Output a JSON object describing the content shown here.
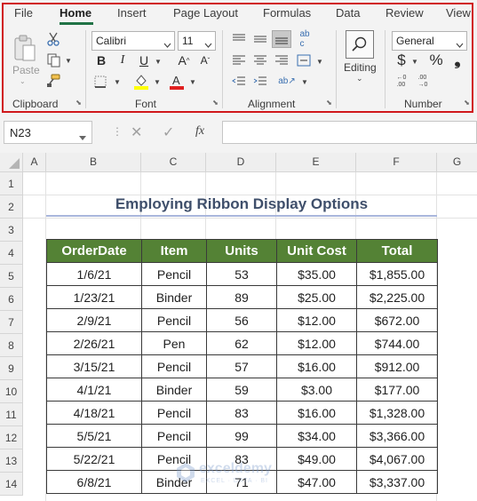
{
  "menu": {
    "tabs": [
      "File",
      "Home",
      "Insert",
      "Page Layout",
      "Formulas",
      "Data",
      "Review",
      "View"
    ],
    "active": "Home"
  },
  "ribbon": {
    "clipboard": {
      "label": "Clipboard",
      "paste_label": "Paste"
    },
    "font": {
      "label": "Font",
      "family": "Calibri",
      "size": "11"
    },
    "alignment": {
      "label": "Alignment"
    },
    "editing": {
      "label": "Editing"
    },
    "number": {
      "label": "Number",
      "format": "General"
    },
    "accent_color": "#d0181b"
  },
  "formula_bar": {
    "name_box": "N23",
    "fx": "fx",
    "value": ""
  },
  "grid": {
    "columns": [
      "A",
      "B",
      "C",
      "D",
      "E",
      "F",
      "G"
    ],
    "rows": [
      "1",
      "2",
      "3",
      "4",
      "5",
      "6",
      "7",
      "8",
      "9",
      "10",
      "11",
      "12",
      "13",
      "14"
    ]
  },
  "sheet": {
    "title": "Employing Ribbon Display Options",
    "headers": [
      "OrderDate",
      "Item",
      "Units",
      "Unit Cost",
      "Total"
    ],
    "rows": [
      [
        "1/6/21",
        "Pencil",
        "53",
        "$35.00",
        "$1,855.00"
      ],
      [
        "1/23/21",
        "Binder",
        "89",
        "$25.00",
        "$2,225.00"
      ],
      [
        "2/9/21",
        "Pencil",
        "56",
        "$12.00",
        "$672.00"
      ],
      [
        "2/26/21",
        "Pen",
        "62",
        "$12.00",
        "$744.00"
      ],
      [
        "3/15/21",
        "Pencil",
        "57",
        "$16.00",
        "$912.00"
      ],
      [
        "4/1/21",
        "Binder",
        "59",
        "$3.00",
        "$177.00"
      ],
      [
        "4/18/21",
        "Pencil",
        "83",
        "$16.00",
        "$1,328.00"
      ],
      [
        "5/5/21",
        "Pencil",
        "99",
        "$34.00",
        "$3,366.00"
      ],
      [
        "5/22/21",
        "Pencil",
        "83",
        "$49.00",
        "$4,067.00"
      ],
      [
        "6/8/21",
        "Binder",
        "71",
        "$47.00",
        "$3,337.00"
      ]
    ],
    "header_color": "#548235"
  },
  "watermark": {
    "name": "exceldemy",
    "tagline": "EXCEL · DATA · BI"
  }
}
